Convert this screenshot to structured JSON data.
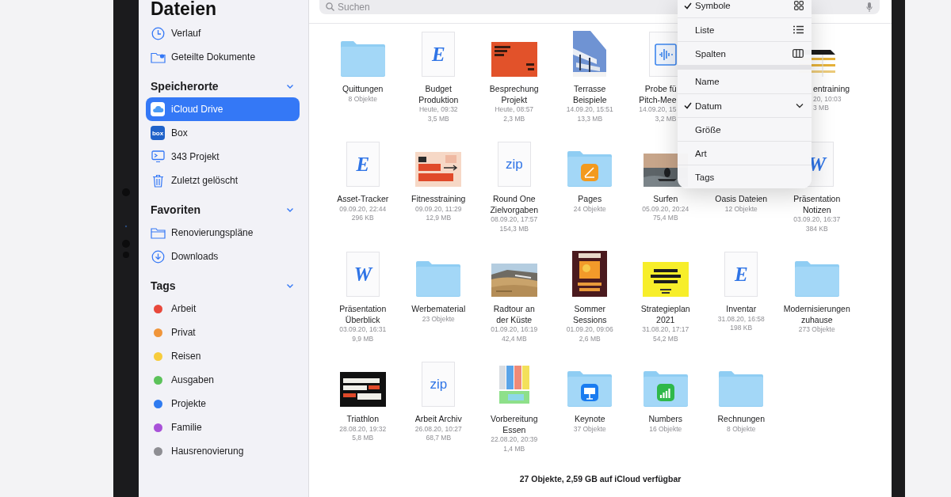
{
  "sidebar": {
    "title": "Dateien",
    "top_items": [
      {
        "label": "Verlauf"
      },
      {
        "label": "Geteilte Dokumente"
      }
    ],
    "sections": [
      {
        "title": "Speicherorte",
        "expanded": true,
        "items": [
          {
            "label": "iCloud Drive",
            "selected": true
          },
          {
            "label": "Box",
            "selected": false,
            "logo_text": "box"
          },
          {
            "label": "343 Projekt",
            "selected": false
          },
          {
            "label": "Zuletzt gelöscht",
            "selected": false
          }
        ]
      },
      {
        "title": "Favoriten",
        "expanded": true,
        "items": [
          {
            "label": "Renovierungspläne",
            "selected": false
          },
          {
            "label": "Downloads",
            "selected": false
          }
        ]
      },
      {
        "title": "Tags",
        "expanded": true,
        "items": [
          {
            "label": "Arbeit",
            "selected": false,
            "color": "#e8483b"
          },
          {
            "label": "Privat",
            "selected": false,
            "color": "#f0953a"
          },
          {
            "label": "Reisen",
            "selected": false,
            "color": "#f7cc3c"
          },
          {
            "label": "Ausgaben",
            "selected": false,
            "color": "#5cc25a"
          },
          {
            "label": "Projekte",
            "selected": false,
            "color": "#2f7bf0"
          },
          {
            "label": "Familie",
            "selected": false,
            "color": "#a851d8"
          },
          {
            "label": "Hausrenovierung",
            "selected": false,
            "color": "#8e8e93"
          }
        ]
      }
    ]
  },
  "search": {
    "placeholder": "Suchen"
  },
  "files": [
    {
      "kind": "tile",
      "name": "Quittungen",
      "thumb": {
        "kind": "folder"
      },
      "count": "8 Objekte"
    },
    {
      "kind": "tile",
      "name": "Budget\nProduktion",
      "thumb": {
        "kind": "document",
        "glyph": "E"
      },
      "date": "Heute, 09:32",
      "size": "3,5 MB"
    },
    {
      "kind": "tile",
      "name": "Besprechung\nProjekt",
      "date": "Heute, 08:57",
      "size": "2,3 MB"
    },
    {
      "kind": "tile",
      "name": "Terrasse\nBeispiele",
      "date": "14.09.20, 15:51",
      "size": "13,3 MB"
    },
    {
      "kind": "rightcut",
      "name": "Probe fü\nPitch-Mee",
      "thumb": {
        "kind": "audio"
      },
      "date": "14.09.20, 15",
      "size": "3,2 MB"
    },
    {
      "kind": "leftcut",
      "name": "entraining",
      "date": "20, 10:03",
      "size": "3 MB"
    },
    {
      "kind": "tile",
      "name": "Asset-Tracker",
      "thumb": {
        "kind": "document",
        "glyph": "E"
      },
      "date": "09.09.20, 22:44",
      "size": "296 KB"
    },
    {
      "kind": "tile",
      "name": "Fitnesstraining",
      "date": "09.09.20, 11:29",
      "size": "12,9 MB"
    },
    {
      "kind": "tile",
      "name": "Round One\nZielvorgaben",
      "thumb": {
        "kind": "archive",
        "glyph": "zip"
      },
      "date": "08.09.20, 17:57",
      "size": "154,3 MB"
    },
    {
      "kind": "tile",
      "name": "Pages",
      "thumb": {
        "kind": "pagesfolder"
      },
      "count": "24 Objekte"
    },
    {
      "kind": "tile",
      "name": "Surfen",
      "date": "05.09.20, 20:24",
      "size": "75,4 MB"
    },
    {
      "kind": "tile",
      "name": "Oasis Dateien",
      "count": "12 Objekte"
    },
    {
      "kind": "tile",
      "name": "Präsentation\nNotizen",
      "thumb": {
        "kind": "document",
        "glyph": "W"
      },
      "date": "03.09.20, 16:37",
      "size": "384 KB"
    },
    {
      "kind": "tile",
      "name": "Präsentation\nÜberblick",
      "thumb": {
        "kind": "document",
        "glyph": "W"
      },
      "date": "03.09.20, 16:31",
      "size": "9,9 MB"
    },
    {
      "kind": "tile",
      "name": "Werbematerial",
      "thumb": {
        "kind": "folder"
      },
      "count": "23 Objekte"
    },
    {
      "kind": "tile",
      "name": "Radtour an\nder Küste",
      "date": "01.09.20, 16:19",
      "size": "42,4 MB"
    },
    {
      "kind": "tile",
      "name": "Sommer\nSessions",
      "date": "01.09.20, 09:06",
      "size": "2,6 MB"
    },
    {
      "kind": "tile",
      "name": "Strategieplan\n2021",
      "date": "31.08.20, 17:17",
      "size": "54,2 MB"
    },
    {
      "kind": "tile",
      "name": "Inventar",
      "thumb": {
        "kind": "document",
        "glyph": "E"
      },
      "date": "31.08.20, 16:58",
      "size": "198 KB"
    },
    {
      "kind": "tile",
      "name": "Modernisierungen\nzuhause",
      "thumb": {
        "kind": "folder"
      },
      "count": "273 Objekte"
    },
    {
      "kind": "tile",
      "name": "Triathlon",
      "date": "28.08.20, 19:32",
      "size": "5,8 MB"
    },
    {
      "kind": "tile",
      "name": "Arbeit Archiv",
      "thumb": {
        "kind": "archive",
        "glyph": "zip"
      },
      "date": "26.08.20, 10:27",
      "size": "68,7 MB"
    },
    {
      "kind": "tile",
      "name": "Vorbereitung\nEssen",
      "date": "22.08.20, 20:39",
      "size": "1,4 MB"
    },
    {
      "kind": "tile",
      "name": "Keynote",
      "thumb": {
        "kind": "keynotefolder"
      },
      "count": "37 Objekte"
    },
    {
      "kind": "tile",
      "name": "Numbers",
      "thumb": {
        "kind": "numbersfolder"
      },
      "count": "16 Objekte"
    },
    {
      "kind": "tile",
      "name": "Rechnungen",
      "thumb": {
        "kind": "folder"
      },
      "count": "8 Objekte"
    }
  ],
  "status": "27 Objekte, 2,59 GB auf iCloud verfügbar",
  "menu": {
    "groups": [
      {
        "items": [
          {
            "kind": "view",
            "label": "Symbole",
            "checked": true
          },
          {
            "kind": "view",
            "label": "Liste",
            "checked": false
          },
          {
            "kind": "view",
            "label": "Spalten",
            "checked": false
          }
        ]
      },
      {
        "items": [
          {
            "kind": "field",
            "label": "Name",
            "checked": false
          },
          {
            "kind": "sortfield",
            "label": "Datum",
            "checked": true
          },
          {
            "kind": "field",
            "label": "Größe",
            "checked": false
          },
          {
            "kind": "field",
            "label": "Art",
            "checked": false
          },
          {
            "kind": "field",
            "label": "Tags",
            "checked": false
          }
        ]
      }
    ]
  }
}
